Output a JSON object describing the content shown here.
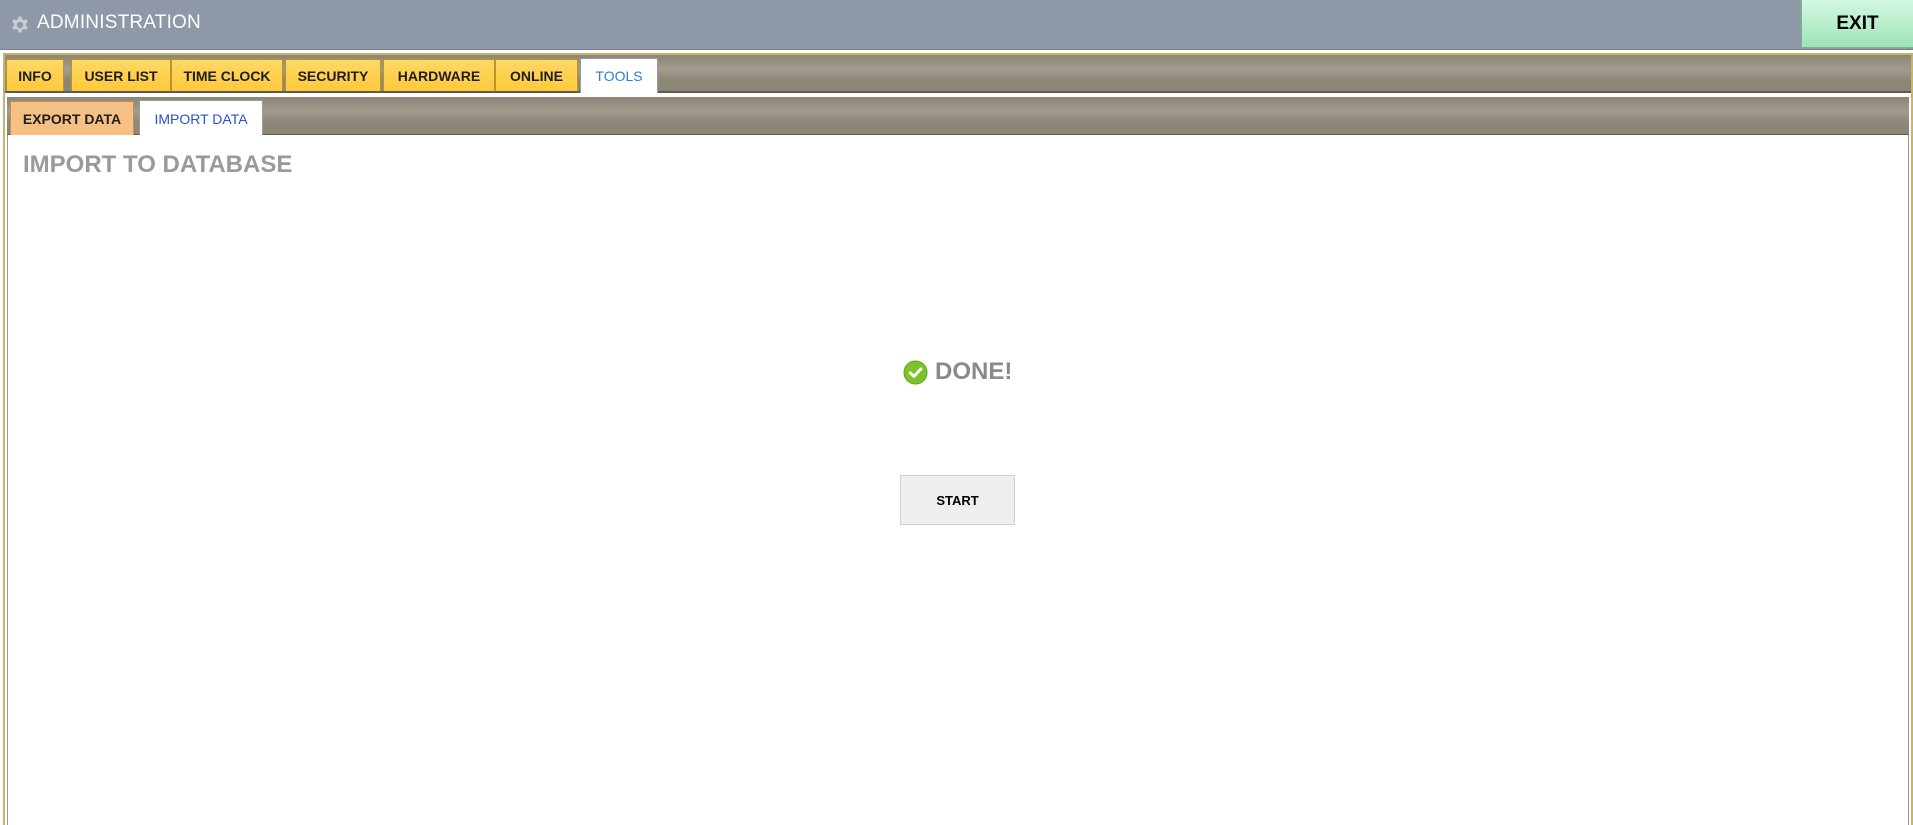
{
  "window": {
    "title": "ADMINISTRATION",
    "icon": "gear-icon",
    "exit_label": "EXIT"
  },
  "main_tabs": [
    {
      "label": "INFO",
      "active": false
    },
    {
      "label": "USER LIST",
      "active": false
    },
    {
      "label": "TIME CLOCK",
      "active": false
    },
    {
      "label": "SECURITY",
      "active": false
    },
    {
      "label": "HARDWARE",
      "active": false
    },
    {
      "label": "ONLINE",
      "active": false
    },
    {
      "label": "TOOLS",
      "active": true
    }
  ],
  "sub_tabs": [
    {
      "label": "EXPORT DATA",
      "active": false
    },
    {
      "label": "IMPORT DATA",
      "active": true
    }
  ],
  "panel": {
    "title": "IMPORT TO DATABASE",
    "status_text": "DONE!",
    "status_icon": "check-circle-icon",
    "start_label": "START"
  },
  "colors": {
    "titlebar": "#8f98a6",
    "tab_yellow": "#ffc93a",
    "tab_orange": "#f6c084",
    "exit_green": "#b4ecc7",
    "success_green": "#7cc42a"
  }
}
